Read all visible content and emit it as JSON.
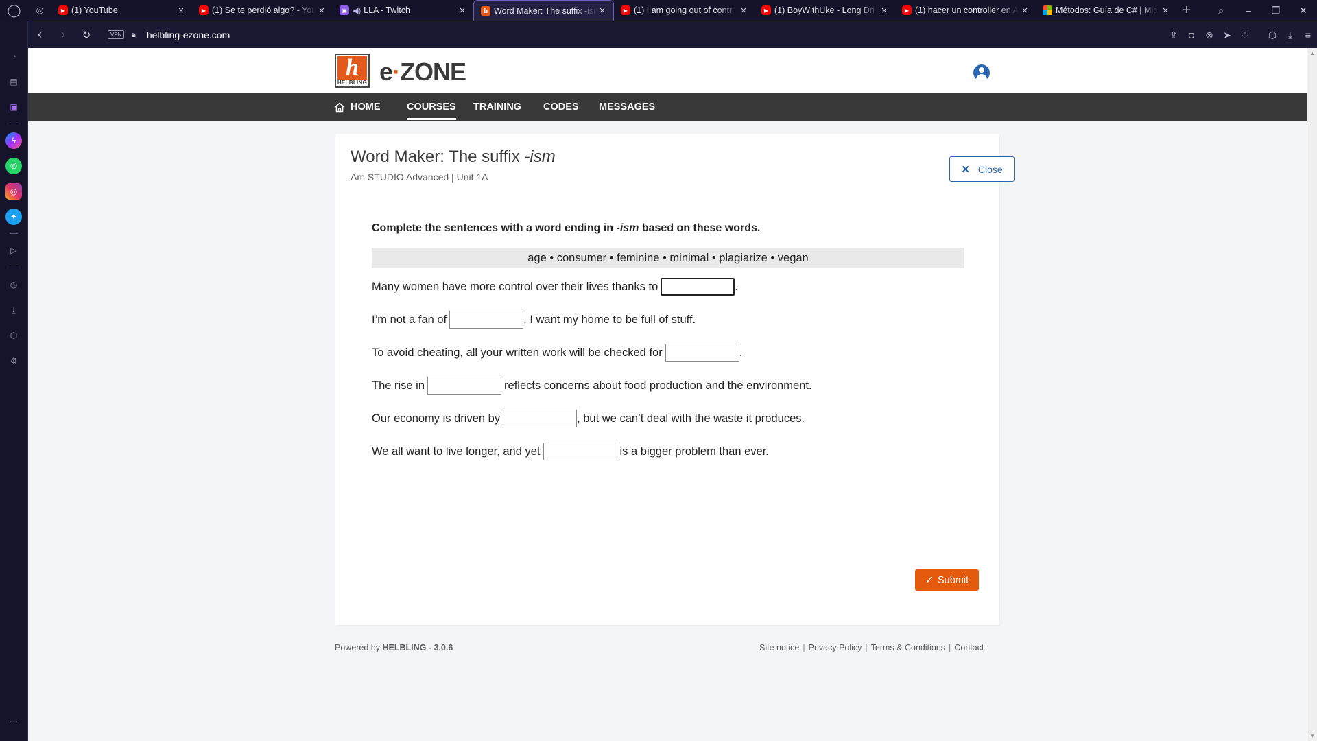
{
  "browser": {
    "tabs": [
      {
        "title": "(1) YouTube",
        "favicon": "youtube-icon"
      },
      {
        "title": "(1) Se te perdió algo? - You",
        "favicon": "youtube-icon"
      },
      {
        "title": "LLA - Twitch",
        "favicon": "twitch-icon",
        "audio": true
      },
      {
        "title": "Word Maker: The suffix -ism",
        "favicon": "helbling-icon",
        "active": true
      },
      {
        "title": "(1) I am going out of contr",
        "favicon": "youtube-icon"
      },
      {
        "title": "(1) BoyWithUke - Long Dri",
        "favicon": "youtube-icon"
      },
      {
        "title": "(1) hacer un controller en A",
        "favicon": "youtube-icon"
      },
      {
        "title": "Métodos: Guía de C# | Mic",
        "favicon": "microsoft-icon"
      }
    ],
    "url": "helbling-ezone.com",
    "vpn_label": "VPN"
  },
  "site": {
    "logo_brand": "HELBLING",
    "logo_letter": "h",
    "name_prefix": "e",
    "name_suffix": "ZONE",
    "nav": {
      "home": "HOME",
      "courses": "COURSES",
      "training": "TRAINING",
      "codes": "CODES",
      "messages": "MESSAGES"
    }
  },
  "exercise": {
    "title_main": "Word Maker: The suffix ",
    "title_suffix": "-ism",
    "subtitle": "Am STUDIO Advanced | Unit 1A",
    "close_label": "Close",
    "instruction_pre": "Complete the sentences with a word ending in ",
    "instruction_suffix": "-ism",
    "instruction_post": " based on these words.",
    "word_bank": "age • consumer • feminine • minimal • plagiarize • vegan",
    "sentences": [
      {
        "before": "Many women have more control over their lives thanks to",
        "after": ".",
        "value": ""
      },
      {
        "before": "I’m not a fan of",
        "after": ". I want my home to be full of stuff.",
        "value": ""
      },
      {
        "before": "To avoid cheating, all your written work will be checked for",
        "after": ".",
        "value": ""
      },
      {
        "before": "The rise in",
        "after": "reflects concerns about food production and the environment.",
        "value": ""
      },
      {
        "before": "Our economy is driven by",
        "after": ", but we can’t deal with the waste it produces.",
        "value": ""
      },
      {
        "before": "We all want to live longer, and yet",
        "after": "is a bigger problem than ever.",
        "value": ""
      }
    ],
    "submit_label": "Submit"
  },
  "footer": {
    "powered_prefix": "Powered by ",
    "powered_brand": "HELBLING - 3.0.6",
    "links": [
      "Site notice",
      "Privacy Policy",
      "Terms & Conditions",
      "Contact"
    ]
  },
  "colors": {
    "brand_orange": "#e35a1c",
    "nav_bg": "#383838",
    "accent_blue": "#2a66b0",
    "submit_orange": "#e35a0c"
  }
}
